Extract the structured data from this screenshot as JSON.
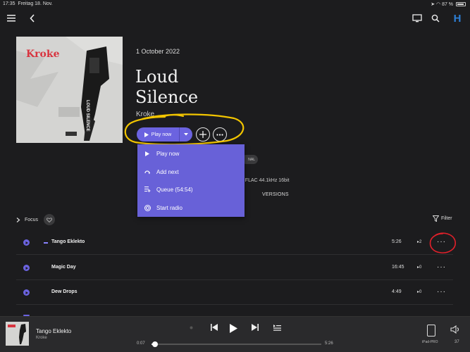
{
  "status_bar": {
    "time": "17:35",
    "date": "Freitag 18. Nov.",
    "battery": "87 %"
  },
  "top_bar": {
    "logo_letter": "H"
  },
  "album": {
    "date": "1 October 2022",
    "title_line1": "Loud",
    "title_line2": "Silence",
    "artist": "Kroke",
    "cover_band_text": "Kroke",
    "cover_album_text": "LOUD SILENCE",
    "tag_fragment": "NAL",
    "quality": "FLAC 44.1kHz 16bit",
    "versions_label": "VERSIONS"
  },
  "actions": {
    "play_now_label": "Play now"
  },
  "dropdown_menu": {
    "items": [
      {
        "label": "Play now",
        "icon": "play-icon"
      },
      {
        "label": "Add next",
        "icon": "add-next-icon"
      },
      {
        "label": "Queue (54:54)",
        "icon": "queue-icon"
      },
      {
        "label": "Start radio",
        "icon": "radio-icon"
      }
    ]
  },
  "list_controls": {
    "focus_label": "Focus",
    "filter_label": "Filter"
  },
  "tracks": [
    {
      "title": "Tango Eklekto",
      "duration": "5:26",
      "plays": "2",
      "playing": true
    },
    {
      "title": "Magic Day",
      "duration": "16:45",
      "plays": "0",
      "playing": false
    },
    {
      "title": "Dew Drops",
      "duration": "4:49",
      "plays": "0",
      "playing": false
    }
  ],
  "player": {
    "title": "Tango Eklekto",
    "artist": "Kroke",
    "current_time": "0:07",
    "total_time": "5:26",
    "progress_fraction": 0.021,
    "device": "iPad-PRO",
    "volume": "37"
  },
  "colors": {
    "accent": "#6b63e0",
    "menu": "#6861d8",
    "background": "#1c1c1e",
    "highlight_yellow": "#f2c500",
    "annotation_red": "#e0202a"
  }
}
